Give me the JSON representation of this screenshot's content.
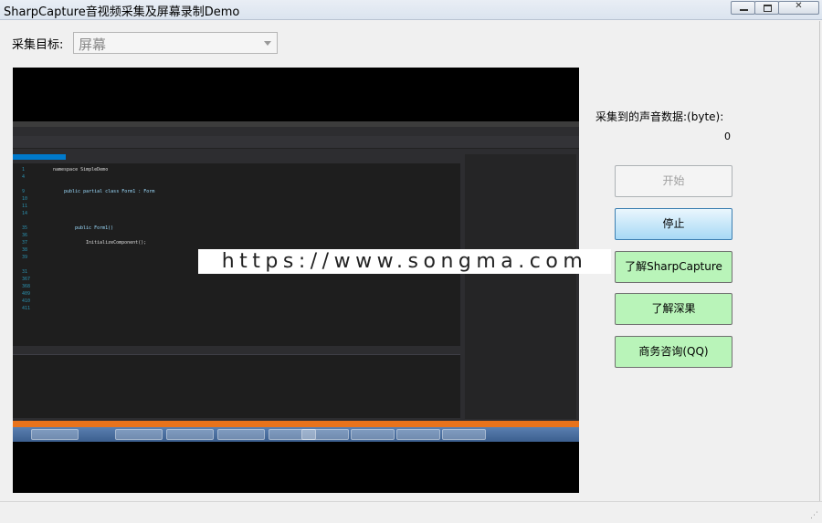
{
  "window": {
    "title": "SharpCapture音视频采集及屏幕录制Demo",
    "minimize_glyph": "",
    "maximize_glyph": "",
    "close_glyph": "✕"
  },
  "capture": {
    "target_label": "采集目标:",
    "target_value": "屏幕"
  },
  "preview": {
    "code_namespace": "namespace SimpleDemo",
    "code_class": "public partial class Form1 : Form",
    "code_ctor": "public Form1()",
    "code_init": "InitializeComponent();",
    "line_numbers": "1\n4\n\n9\n10\n11\n14\n\n35\n36\n37\n38\n39\n\n31\n367\n368\n409\n410\n411",
    "watermark": "https://www.songma.com"
  },
  "audio": {
    "label": "采集到的声音数据:(byte):",
    "value": "0"
  },
  "buttons": {
    "start": "开始",
    "stop": "停止",
    "about_sharp": "了解SharpCapture",
    "about_sm": "了解深果",
    "business_qq": "商务咨询(QQ)"
  },
  "colors": {
    "green_button": "#b9f4b9",
    "stop_button": "#a7d9f5"
  }
}
